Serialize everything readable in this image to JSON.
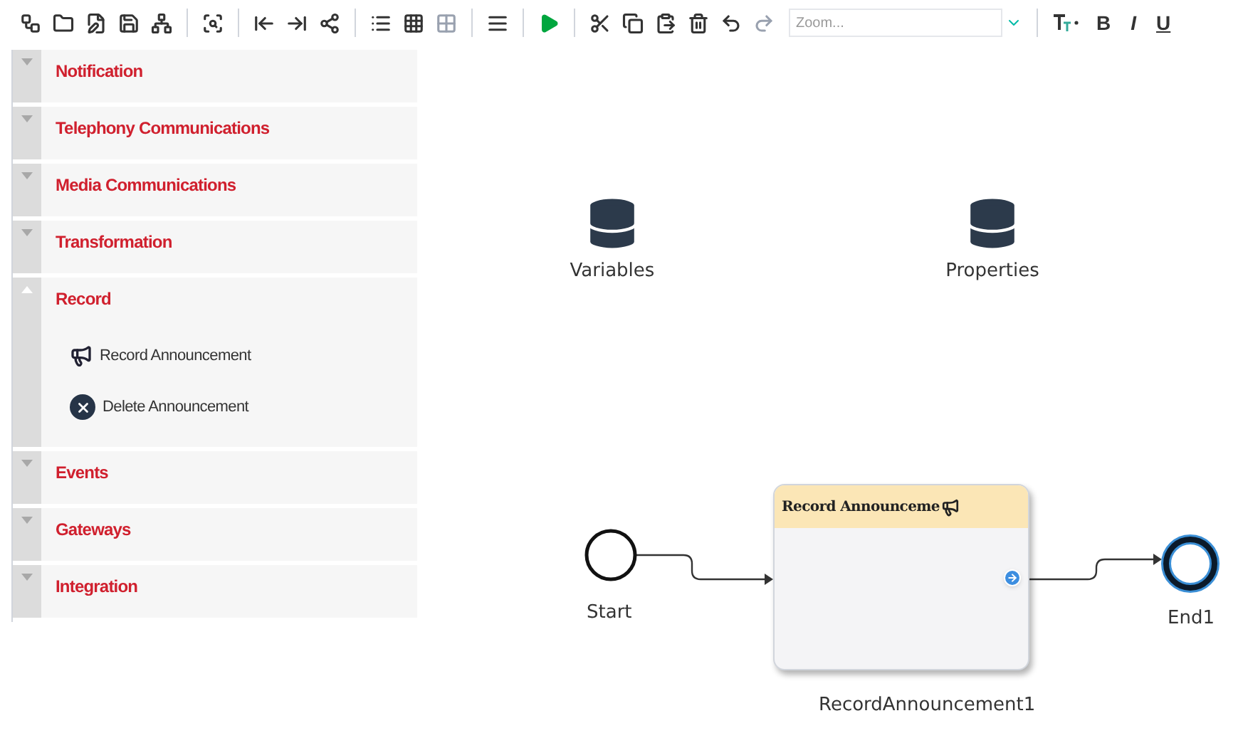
{
  "toolbar": {
    "zoom": {
      "placeholder": "Zoom..."
    },
    "format_buttons": [
      {
        "label": "B",
        "kind": "bold"
      },
      {
        "label": "I",
        "kind": "italic"
      },
      {
        "label": "U",
        "kind": "underline"
      }
    ]
  },
  "palette": {
    "sections": [
      {
        "title": "Notification",
        "expanded": false
      },
      {
        "title": "Telephony Communications",
        "expanded": false
      },
      {
        "title": "Media Communications",
        "expanded": false
      },
      {
        "title": "Transformation",
        "expanded": false
      },
      {
        "title": "Record",
        "expanded": true,
        "items": [
          {
            "label": "Record Announcement",
            "kind": "record"
          },
          {
            "label": "Delete Announcement",
            "kind": "delete"
          }
        ]
      },
      {
        "title": "Events",
        "expanded": false
      },
      {
        "title": "Gateways",
        "expanded": false
      },
      {
        "title": "Integration",
        "expanded": false
      }
    ]
  },
  "canvas": {
    "data_stores": [
      {
        "label": "Variables"
      },
      {
        "label": "Properties"
      }
    ],
    "start": {
      "label": "Start"
    },
    "task": {
      "title": "Record Announceme",
      "label": "RecordAnnouncement1"
    },
    "end": {
      "label": "End1",
      "selected": true
    }
  }
}
